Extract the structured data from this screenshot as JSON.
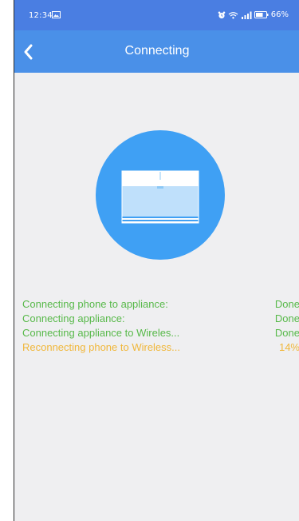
{
  "status_bar": {
    "time": "12:34",
    "battery": "66%"
  },
  "nav": {
    "title": "Connecting"
  },
  "progress": {
    "steps": [
      {
        "label": "Connecting phone to appliance:",
        "status": "Done"
      },
      {
        "label": "Connecting appliance:",
        "status": "Done"
      },
      {
        "label": "Connecting appliance to Wireles...",
        "status": "Done"
      },
      {
        "label": "Reconnecting phone to Wireless...",
        "status": "14%"
      }
    ]
  },
  "colors": {
    "status_bar": "#4a7ee2",
    "nav_bar": "#4a90e8",
    "device_circle": "#3fa0f4",
    "done_text": "#58b94a",
    "active_text": "#f0b73a",
    "screen_background": "#efeff1"
  },
  "icons": {
    "back": "chevron-left-icon",
    "appliance": "air-conditioner-icon"
  }
}
